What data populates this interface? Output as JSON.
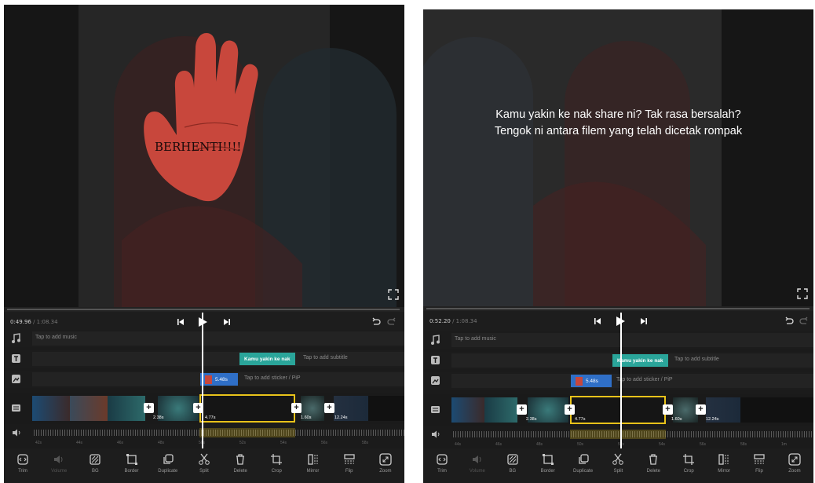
{
  "left": {
    "time_current": "0:49.96",
    "time_total": "/ 1:08.34",
    "hand_text": "BERHENTI!!!!",
    "music_hint": "Tap to add music",
    "subtitle_chip": "Kamu yakin ke nak",
    "subtitle_hint": "Tap to add subtitle",
    "sticker_chip": "5.48s",
    "sticker_hint": "Tap to add sticker / PiP",
    "durations": [
      "2.38s",
      "4.77s",
      "1.60s",
      "12.24s"
    ],
    "ruler": [
      "42s",
      "44s",
      "46s",
      "48s",
      "50s",
      "52s",
      "54s",
      "56s",
      "58s",
      "58s"
    ]
  },
  "right": {
    "time_current": "0:52.20",
    "time_total": "/ 1:08.34",
    "subtitle_line1": "Kamu yakin ke nak share ni? Tak rasa bersalah?",
    "subtitle_line2": "Tengok ni antara filem yang telah dicetak rompak",
    "music_hint": "Tap to add music",
    "subtitle_chip": "Kamu yakin ke nak",
    "subtitle_hint": "Tap to add subtitle",
    "sticker_chip": "5.48s",
    "sticker_hint": "Tap to add sticker / PiP",
    "durations": [
      "2.38s",
      "4.77s",
      "1.60s",
      "12.24s"
    ],
    "ruler": [
      "44s",
      "46s",
      "48s",
      "50s",
      "52s",
      "54s",
      "56s",
      "58s",
      "1m"
    ]
  },
  "toolbar": [
    "Trim",
    "Volume",
    "BG",
    "Border",
    "Duplicate",
    "Split",
    "Delete",
    "Crop",
    "Mirror",
    "Flip",
    "Zoom"
  ],
  "colors": {
    "accent_yellow": "#e8c21a",
    "chip_teal": "#2aa59a",
    "chip_blue": "#2f6fc7",
    "hand_red": "#c8473c"
  }
}
